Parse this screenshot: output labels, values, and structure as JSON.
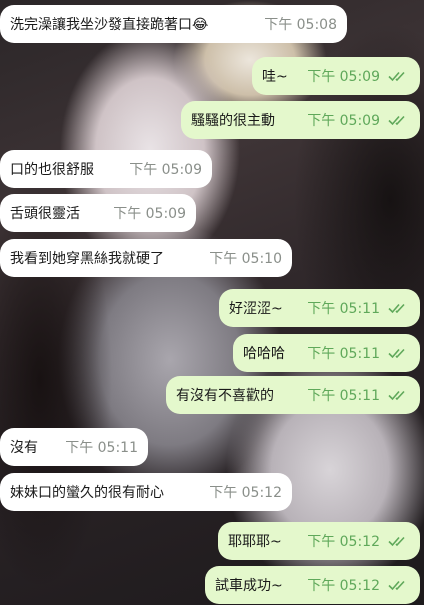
{
  "chat": {
    "messages": [
      {
        "text": "洗完澡讓我坐沙發直接跪著口😂",
        "time": "下午 05:08",
        "dir": "in"
      },
      {
        "text": "哇~",
        "time": "下午 05:09",
        "dir": "out",
        "status": "read-double-check-icon"
      },
      {
        "text": "騷騷的很主動",
        "time": "下午 05:09",
        "dir": "out",
        "status": "read-double-check-icon"
      },
      {
        "text": "口的也很舒服",
        "time": "下午 05:09",
        "dir": "in"
      },
      {
        "text": "舌頭很靈活",
        "time": "下午 05:09",
        "dir": "in"
      },
      {
        "text": "我看到她穿黑絲我就硬了",
        "time": "下午 05:10",
        "dir": "in"
      },
      {
        "text": "好涩涩~",
        "time": "下午 05:11",
        "dir": "out",
        "status": "read-double-check-icon"
      },
      {
        "text": "哈哈哈",
        "time": "下午 05:11",
        "dir": "out",
        "status": "read-double-check-icon"
      },
      {
        "text": "有沒有不喜歡的",
        "time": "下午 05:11",
        "dir": "out",
        "status": "read-double-check-icon"
      },
      {
        "text": "沒有",
        "time": "下午 05:11",
        "dir": "in"
      },
      {
        "text": "妹妹口的蠻久的很有耐心",
        "time": "下午 05:12",
        "dir": "in"
      },
      {
        "text": "耶耶耶~",
        "time": "下午 05:12",
        "dir": "out",
        "status": "read-double-check-icon"
      },
      {
        "text": "試車成功~",
        "time": "下午 05:12",
        "dir": "out",
        "status": "read-double-check-icon"
      }
    ]
  },
  "colors": {
    "incoming_bubble": "#ffffff",
    "outgoing_bubble": "#e4f8cc",
    "read_tick": "#5fa85a"
  }
}
